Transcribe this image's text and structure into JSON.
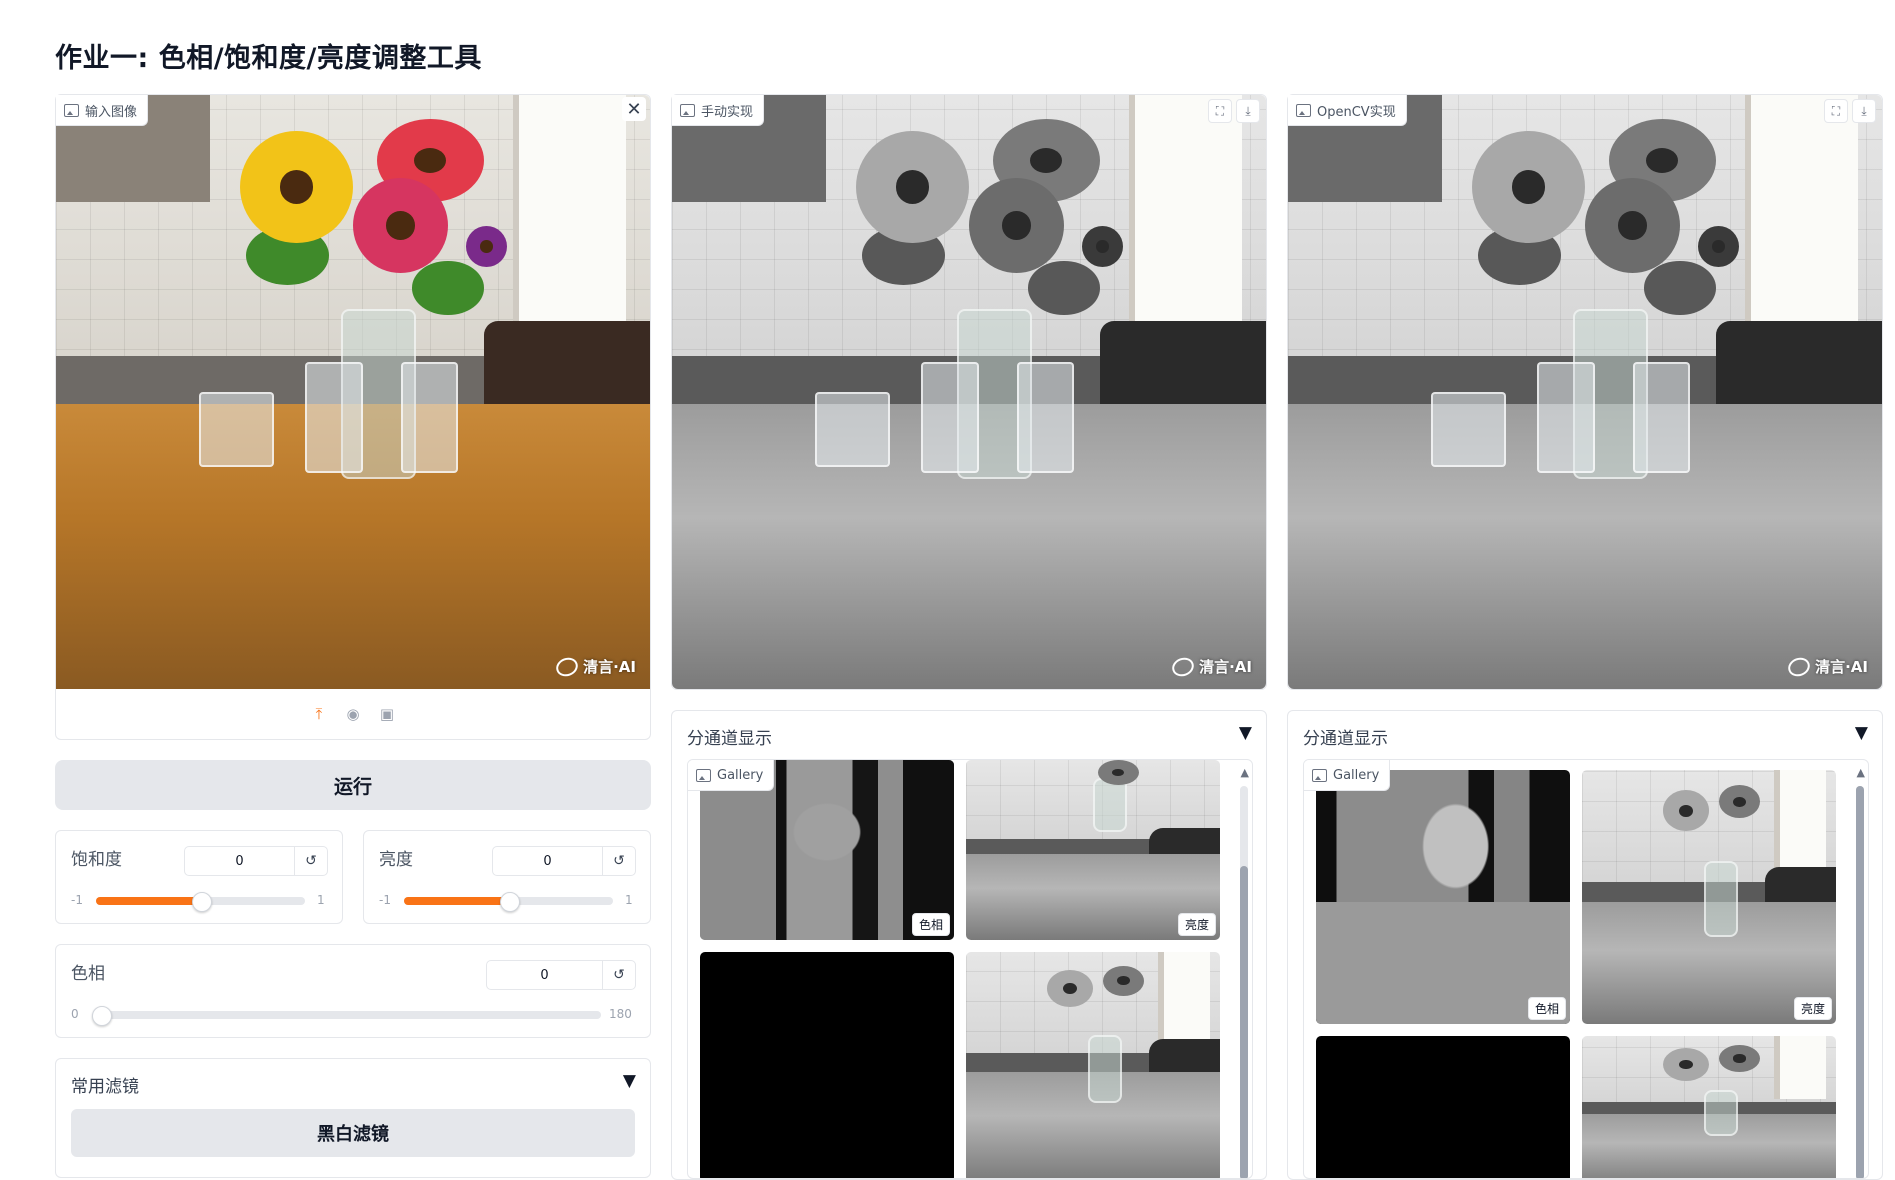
{
  "page": {
    "title": "作业一: 色相/饱和度/亮度调整工具"
  },
  "input_image": {
    "label": "输入图像",
    "watermark": "清言·AI"
  },
  "manual_image": {
    "label": "手动实现",
    "watermark": "清言·AI"
  },
  "opencv_image": {
    "label": "OpenCV实现",
    "watermark": "清言·AI"
  },
  "run_button": {
    "label": "运行"
  },
  "saturation": {
    "label": "饱和度",
    "value": "0",
    "min": "-1",
    "max": "1",
    "level": 0.5
  },
  "brightness": {
    "label": "亮度",
    "value": "0",
    "min": "-1",
    "max": "1",
    "level": 0.5
  },
  "hue": {
    "label": "色相",
    "value": "0",
    "min": "0",
    "max": "180",
    "level": 0
  },
  "filters": {
    "title": "常用滤镜",
    "bw_button": "黑白滤镜"
  },
  "manual_channels": {
    "title": "分通道显示",
    "gallery_label": "Gallery",
    "items": [
      {
        "caption": "色相"
      },
      {
        "caption": "亮度"
      }
    ]
  },
  "opencv_channels": {
    "title": "分通道显示",
    "gallery_label": "Gallery",
    "items": [
      {
        "caption": "色相"
      },
      {
        "caption": "亮度"
      }
    ]
  },
  "icons": {
    "close": "close-icon",
    "fullscreen": "fullscreen-icon",
    "download": "download-icon",
    "upload": "upload-icon",
    "webcam": "webcam-icon",
    "clipboard": "clipboard-icon",
    "reset": "reset-icon",
    "caret": "caret-down-icon"
  },
  "colors": {
    "accent": "#f97316",
    "button_bg": "#e5e7eb",
    "border": "#e5e7eb"
  }
}
